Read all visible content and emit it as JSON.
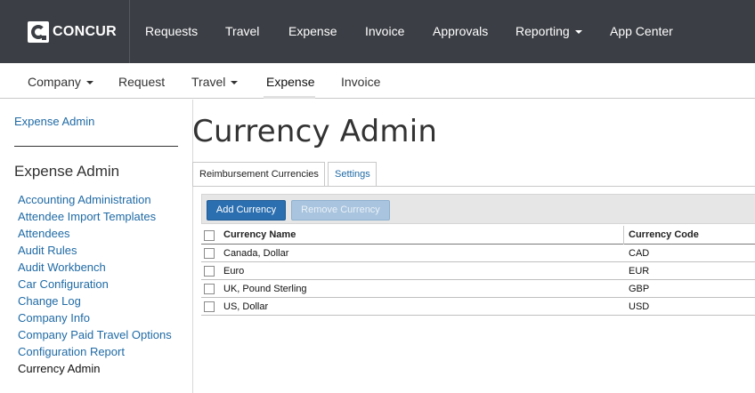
{
  "brand": {
    "logo_text": "CONCUR"
  },
  "top_nav": {
    "items": [
      {
        "label": "Requests"
      },
      {
        "label": "Travel"
      },
      {
        "label": "Expense"
      },
      {
        "label": "Invoice"
      },
      {
        "label": "Approvals"
      },
      {
        "label": "Reporting"
      },
      {
        "label": "App Center"
      }
    ]
  },
  "sub_nav": {
    "items": [
      {
        "label": "Company"
      },
      {
        "label": "Request"
      },
      {
        "label": "Travel"
      },
      {
        "label": "Expense"
      },
      {
        "label": "Invoice"
      }
    ],
    "active": "Expense"
  },
  "sidebar": {
    "top_link": "Expense Admin",
    "heading": "Expense Admin",
    "items": [
      {
        "label": "Accounting Administration"
      },
      {
        "label": "Attendee Import Templates"
      },
      {
        "label": "Attendees"
      },
      {
        "label": "Audit Rules"
      },
      {
        "label": "Audit Workbench"
      },
      {
        "label": "Car Configuration"
      },
      {
        "label": "Change Log"
      },
      {
        "label": "Company Info"
      },
      {
        "label": "Company Paid Travel Options"
      },
      {
        "label": "Configuration Report"
      },
      {
        "label": "Currency Admin"
      }
    ],
    "current": "Currency Admin"
  },
  "main": {
    "title": "Currency Admin",
    "tabs": [
      {
        "label": "Reimbursement Currencies"
      },
      {
        "label": "Settings"
      }
    ],
    "toolbar": {
      "add_label": "Add Currency",
      "remove_label": "Remove Currency"
    },
    "table": {
      "headers": {
        "name": "Currency Name",
        "code": "Currency Code"
      },
      "rows": [
        {
          "name": "Canada, Dollar",
          "code": "CAD"
        },
        {
          "name": "Euro",
          "code": "EUR"
        },
        {
          "name": "UK, Pound Sterling",
          "code": "GBP"
        },
        {
          "name": "US, Dollar",
          "code": "USD"
        }
      ]
    }
  },
  "colors": {
    "topnav_bg": "#3b3e44",
    "link": "#1f6aa5",
    "primary_button": "#2b6fb0"
  }
}
